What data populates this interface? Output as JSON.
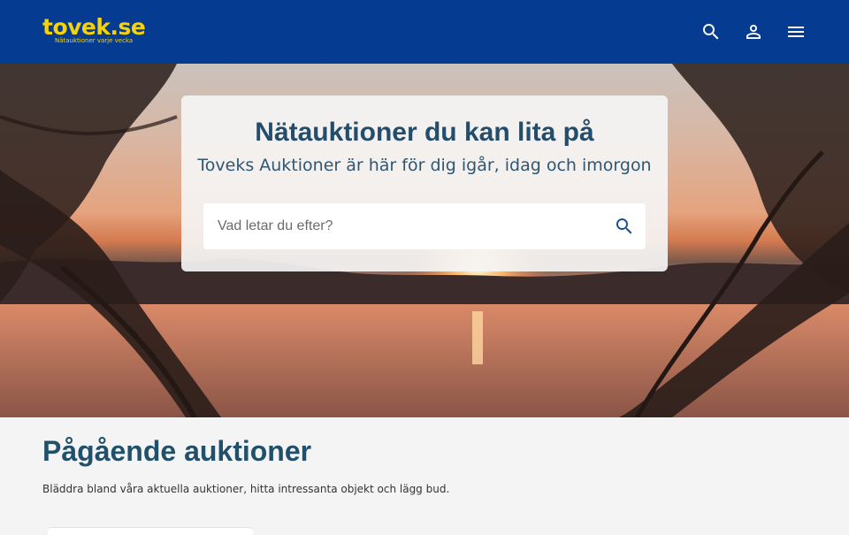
{
  "header": {
    "logo_text": "tovek.se",
    "logo_tagline": "Nätauktioner varje vecka",
    "icons": [
      "search-icon",
      "user-icon",
      "menu-icon"
    ],
    "background_color": "#053c91",
    "logo_color": "#f5d20a"
  },
  "hero": {
    "title": "Nätauktioner du kan lita på",
    "subtitle": "Toveks Auktioner är här för dig igår, idag och imorgon",
    "search": {
      "placeholder": "Vad letar du efter?",
      "value": ""
    }
  },
  "main": {
    "section_title": "Pågående auktioner",
    "section_description": "Bläddra bland våra aktuella auktioner, hitta intressanta objekt och lägg bud."
  }
}
